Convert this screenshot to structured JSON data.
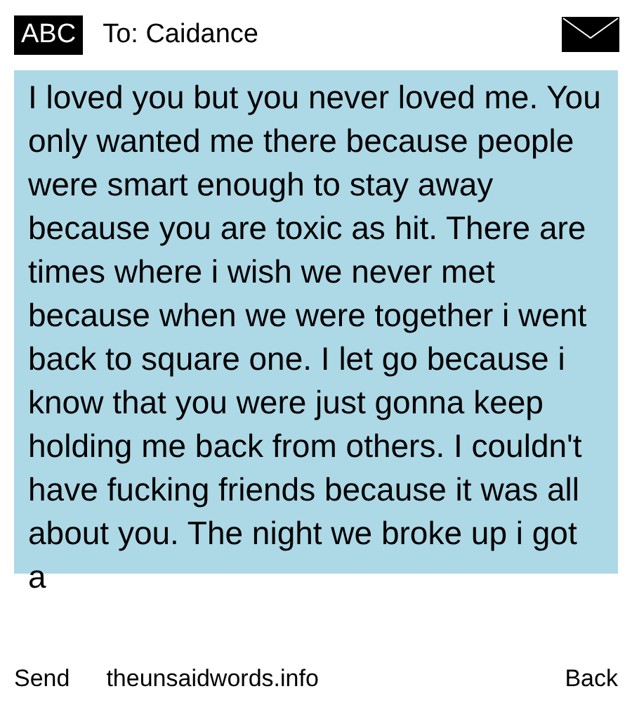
{
  "header": {
    "input_mode": "ABC",
    "recipient": "To: Caidance"
  },
  "message": {
    "text": "I loved you but you never loved me. You only wanted me there because people were smart enough to stay away because you are toxic as hit. There are times where i wish we never met because when we were together i went back to square one. I let go because i know that you were just gonna keep holding me back from others. I couldn't have fucking friends because it was all about you. The night we broke up i got a"
  },
  "softkeys": {
    "left": "Send",
    "center": "theunsaidwords.info",
    "right": "Back"
  }
}
